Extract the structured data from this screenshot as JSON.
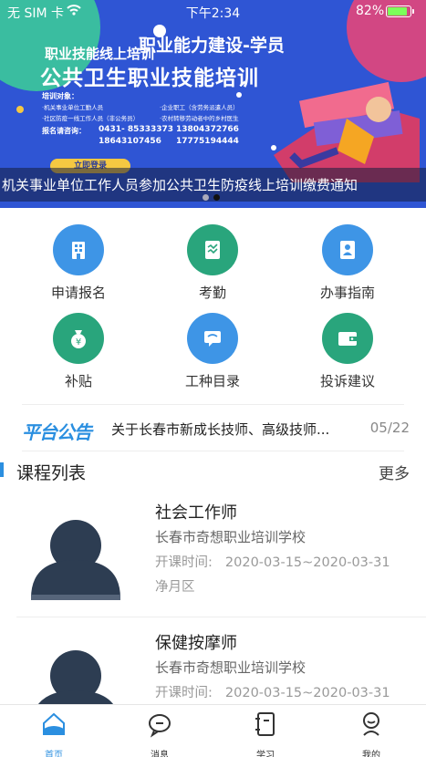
{
  "status_bar": {
    "carrier": "无 SIM 卡",
    "time": "下午2:34",
    "battery": "82%",
    "battery_level": 0.82
  },
  "banner": {
    "subtitle": "职业技能线上培训",
    "heading": "职业能力建设-学员",
    "title": "公共卫生职业技能培训",
    "target_label": "培训对象：",
    "targets": [
      "·机关事业单位工勤人员",
      "·企业职工（含劳务派遣人员）",
      "·社区防疫一线工作人员（非公务员）",
      "·农村转移劳动者中的乡村医生"
    ],
    "contact_label": "报名请咨询：",
    "phones": [
      "0431- 85333373",
      "13804372766",
      "18643107456",
      "17775194444"
    ],
    "button": "立即登录",
    "caption": "机关事业单位工作人员参加公共卫生防疫线上培训缴费通知",
    "colors": {
      "background": "#2f55d4",
      "accent": "#f5c842"
    }
  },
  "menu": [
    {
      "label": "申请报名",
      "icon": "building-icon",
      "color": "#3e95e6"
    },
    {
      "label": "考勤",
      "icon": "attendance-icon",
      "color": "#29a57c"
    },
    {
      "label": "办事指南",
      "icon": "guide-icon",
      "color": "#3e95e6"
    },
    {
      "label": "补贴",
      "icon": "money-bag-icon",
      "color": "#29a57c"
    },
    {
      "label": "工种目录",
      "icon": "catalog-icon",
      "color": "#3e95e6"
    },
    {
      "label": "投诉建议",
      "icon": "wallet-icon",
      "color": "#29a57c"
    }
  ],
  "notice": {
    "logo": "平台公告",
    "text": "关于长春市新成长技师、高级技师...",
    "date": "05/22"
  },
  "courses": {
    "title": "课程列表",
    "more": "更多",
    "time_label": "开课时间:",
    "items": [
      {
        "name": "社会工作师",
        "school": "长春市奇想职业培训学校",
        "time": "2020-03-15~2020-03-31",
        "area": "净月区"
      },
      {
        "name": "保健按摩师",
        "school": "长春市奇想职业培训学校",
        "time": "2020-03-15~2020-03-31",
        "area": ""
      }
    ]
  },
  "tabs": [
    {
      "label": "首页",
      "icon": "home-icon",
      "active": true
    },
    {
      "label": "消息",
      "icon": "message-icon",
      "active": false
    },
    {
      "label": "学习",
      "icon": "study-icon",
      "active": false
    },
    {
      "label": "我的",
      "icon": "profile-icon",
      "active": false
    }
  ]
}
